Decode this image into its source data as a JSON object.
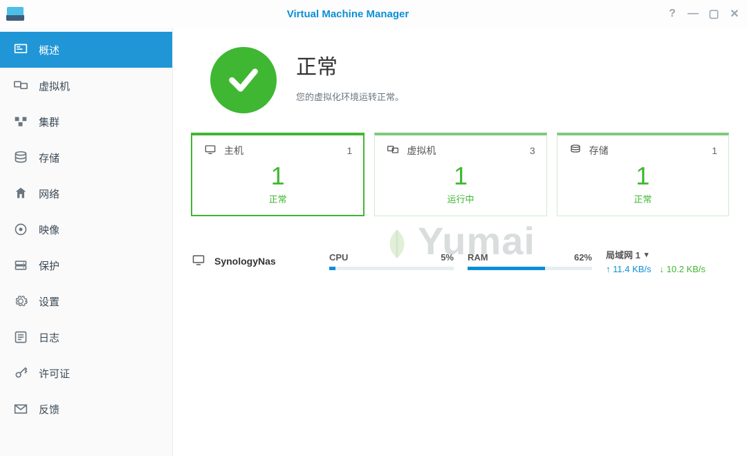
{
  "app": {
    "title": "Virtual Machine Manager"
  },
  "sidebar": {
    "items": [
      {
        "label": "概述"
      },
      {
        "label": "虚拟机"
      },
      {
        "label": "集群"
      },
      {
        "label": "存储"
      },
      {
        "label": "网络"
      },
      {
        "label": "映像"
      },
      {
        "label": "保护"
      },
      {
        "label": "设置"
      },
      {
        "label": "日志"
      },
      {
        "label": "许可证"
      },
      {
        "label": "反馈"
      }
    ]
  },
  "status": {
    "heading": "正常",
    "description": "您的虚拟化环境运转正常。"
  },
  "cards": {
    "host": {
      "title": "主机",
      "count": "1",
      "number": "1",
      "sub": "正常"
    },
    "vm": {
      "title": "虚拟机",
      "count": "3",
      "number": "1",
      "sub": "运行中"
    },
    "storage": {
      "title": "存储",
      "count": "1",
      "number": "1",
      "sub": "正常"
    }
  },
  "host_row": {
    "name": "SynologyNas",
    "cpu_label": "CPU",
    "cpu_pct": "5%",
    "ram_label": "RAM",
    "ram_pct": "62%",
    "lan_label": "局域网 1",
    "up": "11.4 KB/s",
    "down": "10.2 KB/s"
  },
  "watermark": "Yumai"
}
